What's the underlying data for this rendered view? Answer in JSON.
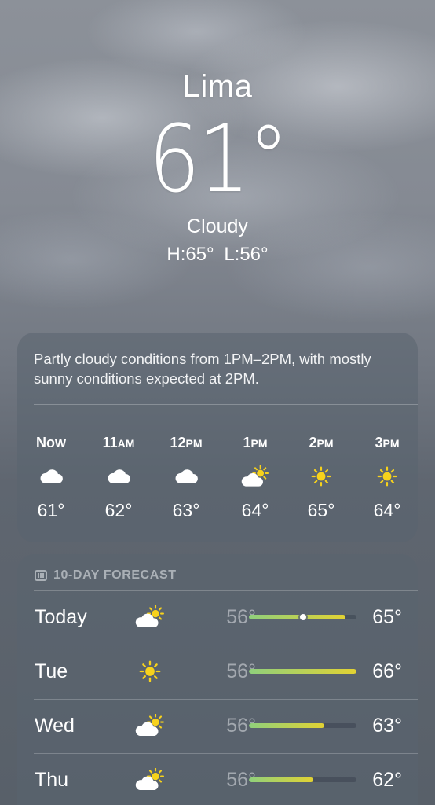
{
  "location": {
    "city": "Lima",
    "temperature": "61°",
    "condition": "Cloudy",
    "high_low": "H:65°  L:56°"
  },
  "hourly": {
    "summary": "Partly cloudy conditions from 1PM–2PM, with mostly sunny conditions expected at 2PM.",
    "hours": [
      {
        "time": "Now",
        "icon": "cloud-icon",
        "temp": "61°"
      },
      {
        "time": "11AM",
        "icon": "cloud-icon",
        "temp": "62°"
      },
      {
        "time": "12PM",
        "icon": "cloud-icon",
        "temp": "63°"
      },
      {
        "time": "1PM",
        "icon": "partly-sunny-icon",
        "temp": "64°"
      },
      {
        "time": "2PM",
        "icon": "sun-icon",
        "temp": "65°"
      },
      {
        "time": "3PM",
        "icon": "sun-icon",
        "temp": "64°"
      }
    ]
  },
  "daily": {
    "header": "10-DAY FORECAST",
    "range_min": 56,
    "range_max": 66,
    "days": [
      {
        "day": "Today",
        "icon": "partly-sunny-icon",
        "low": "56°",
        "high": "65°",
        "low_val": 56,
        "high_val": 65,
        "current_val": 61
      },
      {
        "day": "Tue",
        "icon": "sun-icon",
        "low": "56°",
        "high": "66°",
        "low_val": 56,
        "high_val": 66
      },
      {
        "day": "Wed",
        "icon": "partly-sunny-icon",
        "low": "56°",
        "high": "63°",
        "low_val": 56,
        "high_val": 63
      },
      {
        "day": "Thu",
        "icon": "partly-sunny-icon",
        "low": "56°",
        "high": "62°",
        "low_val": 56,
        "high_val": 62
      }
    ]
  },
  "colors": {
    "sun": "#f7d21c",
    "bar_cool": "#8fd07c",
    "bar_warm": "#e2d233"
  }
}
